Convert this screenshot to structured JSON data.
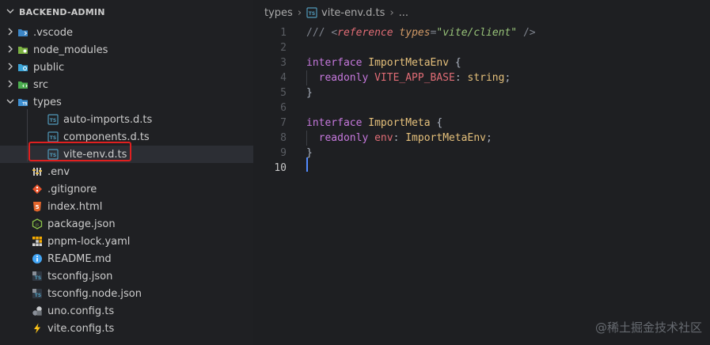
{
  "explorer": {
    "title": "BACKEND-ADMIN",
    "items": [
      {
        "label": ".vscode",
        "type": "folder",
        "icon": "vscode-folder-icon",
        "depth": 0,
        "expanded": false
      },
      {
        "label": "node_modules",
        "type": "folder",
        "icon": "node-folder-icon",
        "depth": 0,
        "expanded": false
      },
      {
        "label": "public",
        "type": "folder",
        "icon": "public-folder-icon",
        "depth": 0,
        "expanded": false
      },
      {
        "label": "src",
        "type": "folder",
        "icon": "src-folder-icon",
        "depth": 0,
        "expanded": false
      },
      {
        "label": "types",
        "type": "folder",
        "icon": "types-folder-icon",
        "depth": 0,
        "expanded": true
      },
      {
        "label": "auto-imports.d.ts",
        "type": "file",
        "icon": "typescript-def-icon",
        "depth": 1
      },
      {
        "label": "components.d.ts",
        "type": "file",
        "icon": "typescript-def-icon",
        "depth": 1
      },
      {
        "label": "vite-env.d.ts",
        "type": "file",
        "icon": "typescript-def-icon",
        "depth": 1,
        "selected": true
      },
      {
        "label": ".env",
        "type": "file",
        "icon": "env-icon",
        "depth": 0
      },
      {
        "label": ".gitignore",
        "type": "file",
        "icon": "git-icon",
        "depth": 0
      },
      {
        "label": "index.html",
        "type": "file",
        "icon": "html-icon",
        "depth": 0
      },
      {
        "label": "package.json",
        "type": "file",
        "icon": "nodejs-icon",
        "depth": 0
      },
      {
        "label": "pnpm-lock.yaml",
        "type": "file",
        "icon": "pnpm-icon",
        "depth": 0
      },
      {
        "label": "README.md",
        "type": "file",
        "icon": "info-icon",
        "depth": 0
      },
      {
        "label": "tsconfig.json",
        "type": "file",
        "icon": "tsconfig-icon",
        "depth": 0
      },
      {
        "label": "tsconfig.node.json",
        "type": "file",
        "icon": "tsconfig-icon",
        "depth": 0
      },
      {
        "label": "uno.config.ts",
        "type": "file",
        "icon": "unocss-icon",
        "depth": 0
      },
      {
        "label": "vite.config.ts",
        "type": "file",
        "icon": "vite-icon",
        "depth": 0
      }
    ]
  },
  "breadcrumb": {
    "folder": "types",
    "file": "vite-env.d.ts",
    "ellipsis": "..."
  },
  "editor": {
    "active_line": 10,
    "lines": [
      {
        "n": "1",
        "tokens": [
          {
            "t": "/// ",
            "c": "comment"
          },
          {
            "t": "<",
            "c": "comment"
          },
          {
            "t": "reference",
            "c": "tag"
          },
          {
            "t": " ",
            "c": "comment"
          },
          {
            "t": "types",
            "c": "attr"
          },
          {
            "t": "=",
            "c": "comment"
          },
          {
            "t": "\"vite/client\"",
            "c": "string"
          },
          {
            "t": " />",
            "c": "comment"
          }
        ]
      },
      {
        "n": "2",
        "tokens": []
      },
      {
        "n": "3",
        "tokens": [
          {
            "t": "interface ",
            "c": "keyword"
          },
          {
            "t": "ImportMetaEnv",
            "c": "type"
          },
          {
            "t": " {",
            "c": "punct"
          }
        ]
      },
      {
        "n": "4",
        "tokens": [
          {
            "t": "  readonly ",
            "c": "keyword"
          },
          {
            "t": "VITE_APP_BASE",
            "c": "prop"
          },
          {
            "t": ": ",
            "c": "punct"
          },
          {
            "t": "string",
            "c": "type"
          },
          {
            "t": ";",
            "c": "punct"
          }
        ]
      },
      {
        "n": "5",
        "tokens": [
          {
            "t": "}",
            "c": "punct"
          }
        ]
      },
      {
        "n": "6",
        "tokens": []
      },
      {
        "n": "7",
        "tokens": [
          {
            "t": "interface ",
            "c": "keyword"
          },
          {
            "t": "ImportMeta",
            "c": "type"
          },
          {
            "t": " {",
            "c": "punct"
          }
        ]
      },
      {
        "n": "8",
        "tokens": [
          {
            "t": "  readonly ",
            "c": "keyword"
          },
          {
            "t": "env",
            "c": "prop"
          },
          {
            "t": ": ",
            "c": "punct"
          },
          {
            "t": "ImportMetaEnv",
            "c": "type"
          },
          {
            "t": ";",
            "c": "punct"
          }
        ]
      },
      {
        "n": "9",
        "tokens": [
          {
            "t": "}",
            "c": "punct"
          }
        ]
      },
      {
        "n": "10",
        "tokens": []
      }
    ]
  },
  "watermark": "@稀土掘金技术社区",
  "colors": {
    "background": "#1e1f22",
    "selection_highlight": "#e02020",
    "cursor": "#528bff"
  }
}
